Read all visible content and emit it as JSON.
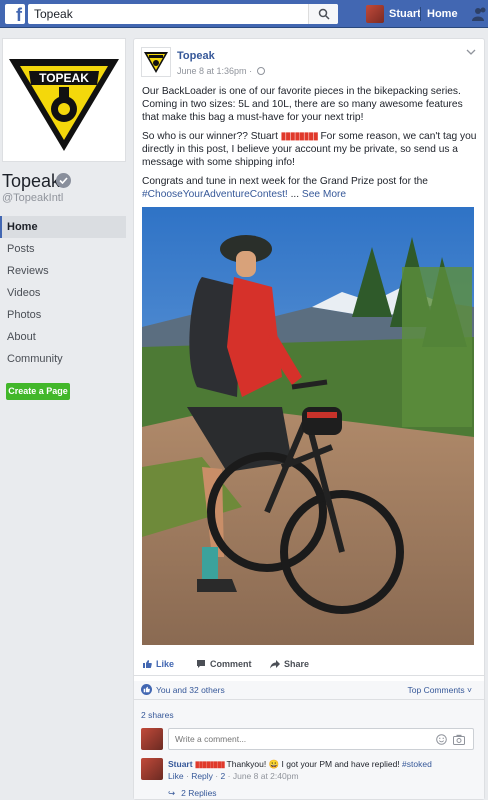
{
  "topbar": {
    "search_value": "Topeak",
    "user_name": "Stuart",
    "home_label": "Home",
    "brand_color": "#4267b2"
  },
  "page": {
    "logo_text": "TOPEAK",
    "name": "Topeak",
    "handle": "@TopeakIntl"
  },
  "nav": {
    "items": [
      {
        "label": "Home",
        "active": true
      },
      {
        "label": "Posts"
      },
      {
        "label": "Reviews"
      },
      {
        "label": "Videos"
      },
      {
        "label": "Photos"
      },
      {
        "label": "About"
      },
      {
        "label": "Community"
      }
    ],
    "create_page": "Create a Page"
  },
  "post": {
    "author": "Topeak",
    "time": "June 8 at 1:36pm",
    "dot": "·",
    "paragraph1": "Our BackLoader is one of our favorite pieces in the bikepacking series. Coming in two sizes: 5L and 10L, there are so many awesome features that make this bag a must-have for your next trip!",
    "paragraph2_start": "So who is our winner?? Stuart ",
    "paragraph2_redacted": "▮▮▮▮▮▮▮▮",
    "paragraph2_end": " For some reason, we can't tag you directly in this post, I believe your account my be private, so send us a message with some shipping info!",
    "paragraph3": "Congrats and tune in next week for the Grand Prize post for the",
    "hashtag": "#ChooseYourAdventureContest!",
    "ellipsis": " ... ",
    "see_more": "See More"
  },
  "actions": {
    "like": "Like",
    "comment": "Comment",
    "share": "Share"
  },
  "reactions": {
    "summary": "You and 32 others",
    "top_comments": "Top Comments ˅"
  },
  "comments": {
    "shares": "2 shares",
    "placeholder": "Write a comment...",
    "comment1": {
      "name_start": "Stuart ",
      "name_redacted": "▮▮▮▮▮▮▮▮",
      "text": " Thankyou! 😀 I got your PM and have replied! ",
      "hashtag": "#stoked",
      "like": "Like",
      "reply": "Reply",
      "reaction_count": "2",
      "time": "June 8 at 2:40pm",
      "sep": "·"
    },
    "replies": "2 Replies"
  }
}
